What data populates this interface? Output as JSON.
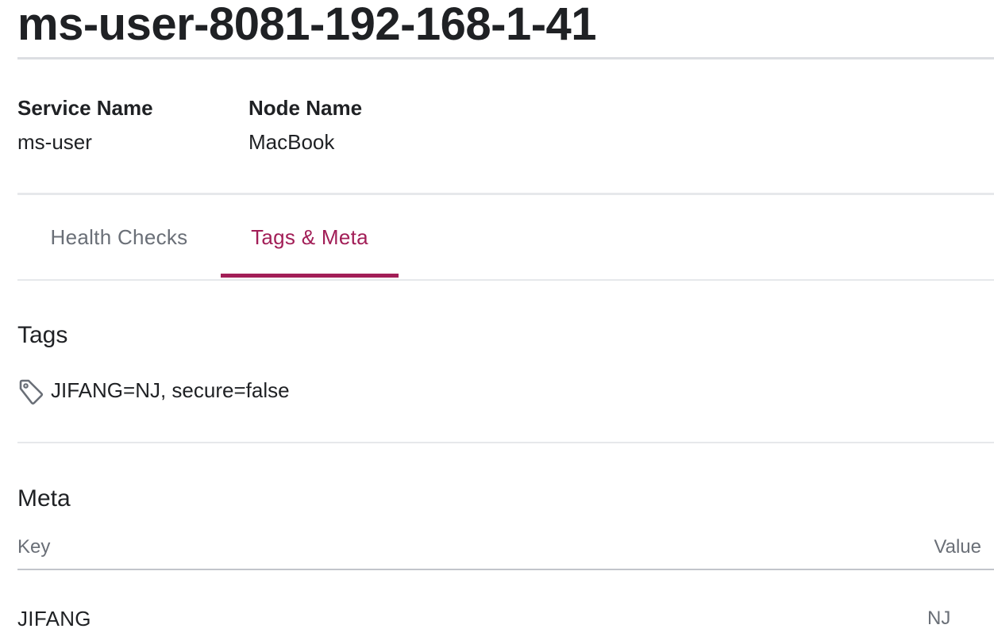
{
  "page": {
    "title": "ms-user-8081-192-168-1-41"
  },
  "info": {
    "service_name_label": "Service Name",
    "service_name_value": "ms-user",
    "node_name_label": "Node Name",
    "node_name_value": "MacBook"
  },
  "tabs": [
    {
      "label": "Health Checks",
      "active": false
    },
    {
      "label": "Tags & Meta",
      "active": true
    }
  ],
  "colors": {
    "accent": "#a21e57",
    "text": "#1f2124",
    "muted": "#6a6f77",
    "divider": "#e6e8eb"
  },
  "tags_section": {
    "title": "Tags",
    "icon": "tag-icon",
    "text": "JIFANG=NJ, secure=false"
  },
  "meta_section": {
    "title": "Meta",
    "columns": {
      "key": "Key",
      "value": "Value"
    },
    "rows": [
      {
        "key": "JIFANG",
        "value": "NJ"
      }
    ]
  }
}
